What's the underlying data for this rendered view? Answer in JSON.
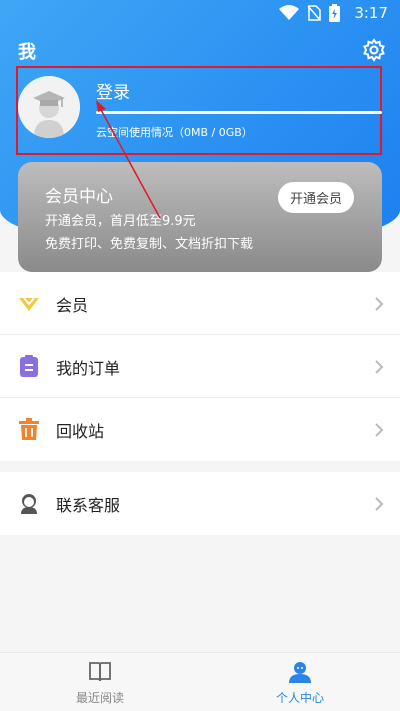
{
  "status_bar": {
    "time": "3:17",
    "icons": [
      "wifi-icon",
      "no-sim-icon",
      "battery-charging-icon"
    ]
  },
  "header": {
    "title": "我",
    "settings_icon": "gear-icon"
  },
  "profile": {
    "login_label": "登录",
    "storage_text": "云空间使用情况（0MB / 0GB）",
    "avatar_icon": "graduate-avatar-icon"
  },
  "member_card": {
    "title": "会员中心",
    "line1": "开通会员，首月低至9.9元",
    "line2": "免费打印、免费复制、文档折扣下载",
    "button_label": "开通会员"
  },
  "menu": [
    {
      "label": "会员",
      "icon": "vip-diamond-icon",
      "color": "#f2c744"
    },
    {
      "label": "我的订单",
      "icon": "clipboard-icon",
      "color": "#8a6fe3"
    },
    {
      "label": "回收站",
      "icon": "trash-icon",
      "color": "#f2832c"
    }
  ],
  "menu2": [
    {
      "label": "联系客服",
      "icon": "customer-service-icon",
      "color": "#555555"
    }
  ],
  "bottom_nav": [
    {
      "label": "最近阅读",
      "icon": "book-icon",
      "active": false
    },
    {
      "label": "个人中心",
      "icon": "person-icon",
      "active": true
    }
  ],
  "colors": {
    "header_blue": "#1c7ff0",
    "active_blue": "#2b84e8",
    "highlight_red": "#e0192b"
  }
}
